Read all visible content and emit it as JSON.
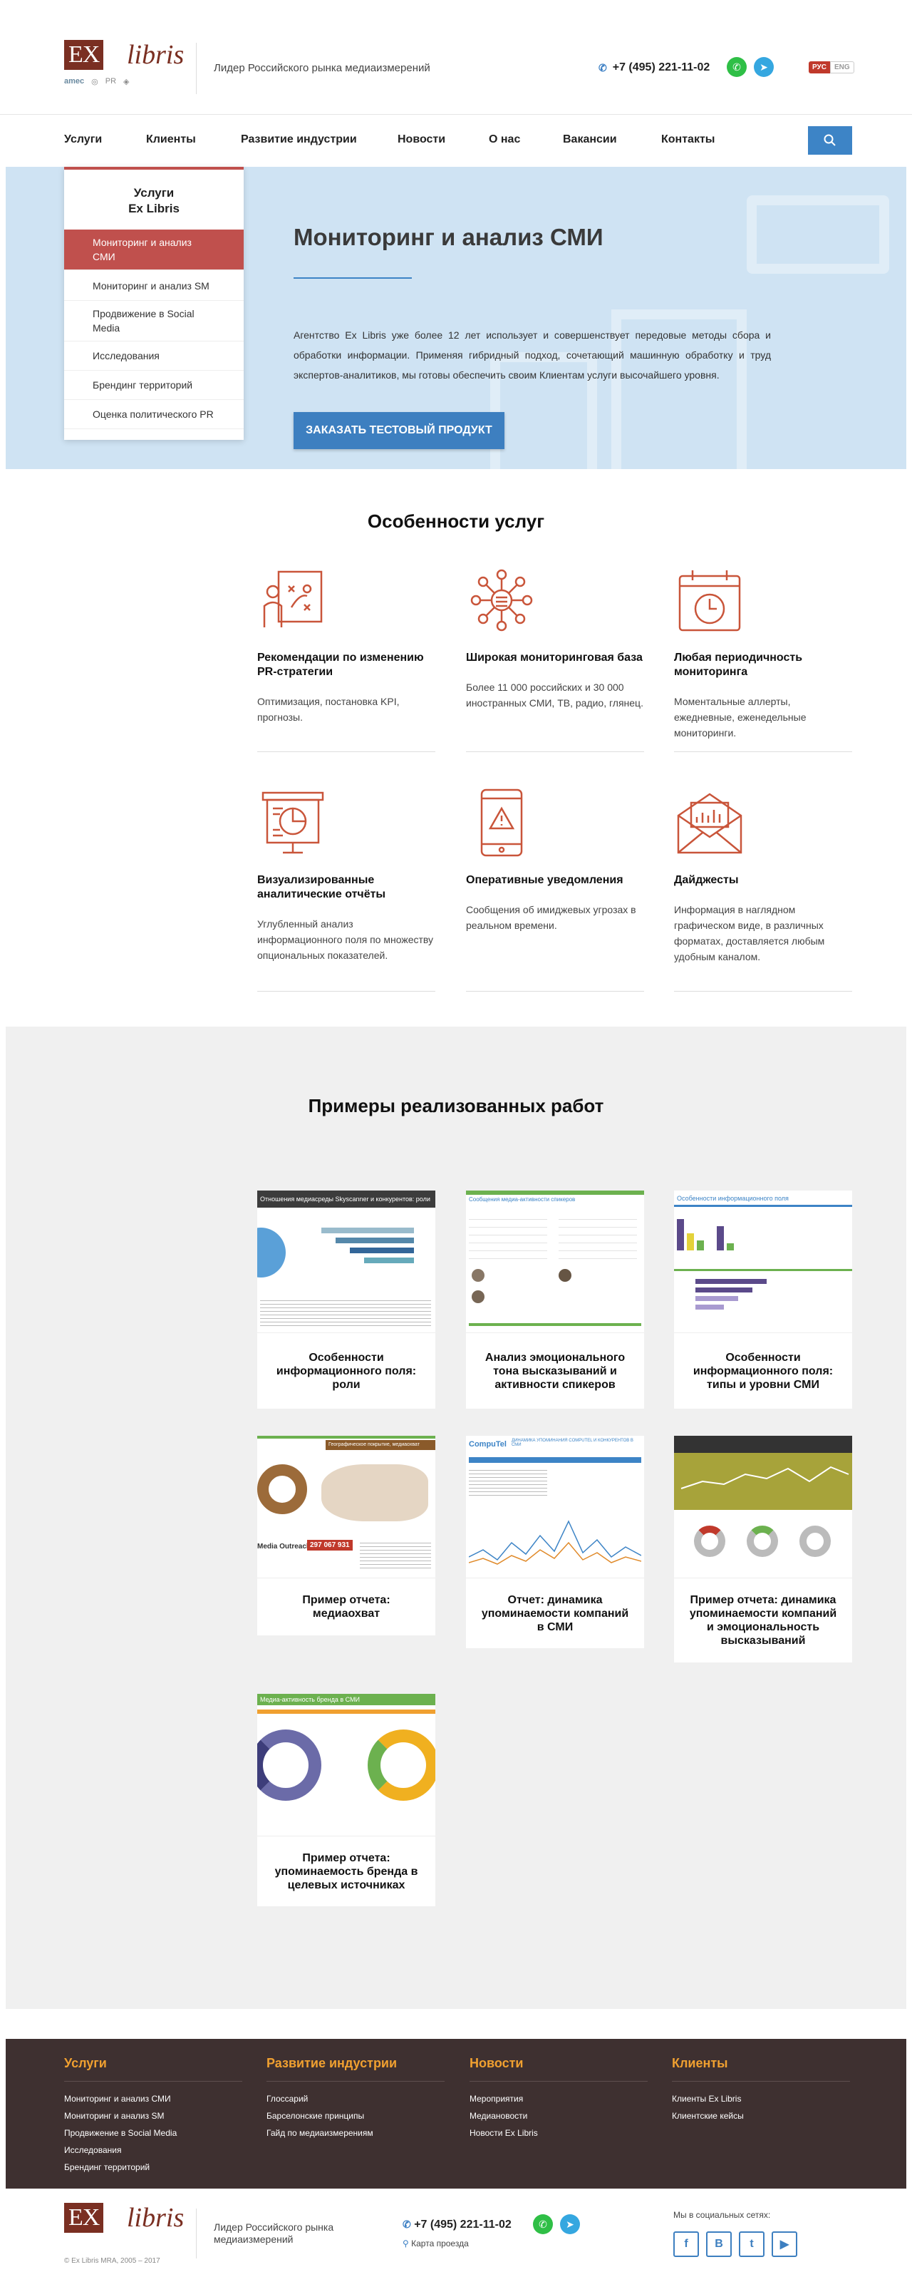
{
  "header": {
    "logo_ex": "EX",
    "logo_libris": "libris",
    "logo_sub": [
      "amec",
      "PR"
    ],
    "tagline": "Лидер Российского рынка медиаизмерений",
    "phone": "+7 (495) 221-11-02",
    "lang_ru": "РУС",
    "lang_en": "ENG"
  },
  "nav": {
    "items": [
      "Услуги",
      "Клиенты",
      "Развитие индустрии",
      "Новости",
      "О нас",
      "Вакансии",
      "Контакты"
    ]
  },
  "dropdown": {
    "title_line1": "Услуги",
    "title_line2": "Ex Libris",
    "items": [
      "Мониторинг и анализ СМИ",
      "Мониторинг и анализ SM",
      "Продвижение в Social Media",
      "Исследования",
      "Брендинг территорий",
      "Оценка политического PR"
    ]
  },
  "hero": {
    "title": "Мониторинг и анализ СМИ",
    "text": "Агентство Ex Libris уже более 12 лет использует и совершенствует передовые методы сбора и обработки информации. Применяя гибридный подход, сочетающий машинную обработку и труд экспертов-аналитиков, мы готовы обеспечить своим Клиентам услуги высочайшего уровня.",
    "button": "ЗАКАЗАТЬ ТЕСТОВЫЙ ПРОДУКТ"
  },
  "features": {
    "title": "Особенности услуг",
    "items": [
      {
        "title": "Рекомендации по изменению PR-стратегии",
        "desc": "Оптимизация, постановка KPI, прогнозы.",
        "icon": "strategy-icon"
      },
      {
        "title": "Широкая мониторинговая база",
        "desc": "Более 11 000 российских и 30 000 иностранных СМИ, ТВ, радио, глянец.",
        "icon": "network-icon"
      },
      {
        "title": "Любая периодичность мониторинга",
        "desc": "Моментальные аллерты, ежедневные, еженедельные мониторинги.",
        "icon": "calendar-clock-icon"
      },
      {
        "title": "Визуализированные аналитические отчёты",
        "desc": "Углубленный анализ информационного поля по множеству опциональных показателей.",
        "icon": "presentation-icon"
      },
      {
        "title": "Оперативные уведомления",
        "desc": "Сообщения об имиджевых угрозах в реальном времени.",
        "icon": "phone-alert-icon"
      },
      {
        "title": "Дайджесты",
        "desc": "Информация в наглядном графическом виде, в различных форматах, доставляется любым удобным каналом.",
        "icon": "envelope-chart-icon"
      }
    ]
  },
  "works": {
    "title": "Примеры реализованных работ",
    "items": [
      {
        "title": "Особенности информационного поля: роли"
      },
      {
        "title": "Анализ эмоционального тона высказываний и активности спикеров"
      },
      {
        "title": "Особенности информационного поля: типы и уровни СМИ"
      },
      {
        "title": "Пример отчета: медиаохват"
      },
      {
        "title": "Отчет: динамика упоминаемости компаний в СМИ"
      },
      {
        "title": "Пример отчета: динамика упоминаемости компаний и эмоциональность высказываний"
      },
      {
        "title": "Пример отчета: упоминаемость бренда в целевых источниках"
      }
    ],
    "thumb_text": {
      "t1": "Отношения медиасреды Skyscanner и конкурентов: роли",
      "t2": "Сообщения медиа-активности спикеров",
      "t3": "Особенности информационного поля",
      "t4": "Географическое покрытие, медиаохват",
      "t4_num": "297 067 931",
      "t4_brand": "Media Outreach",
      "t5": "ДИНАМИКА УПОМИНАНИЯ COMPUTEL И КОНКУРЕНТОВ В СМИ",
      "t5_brand": "CompuTel",
      "t7": "Медиа-активность бренда в СМИ"
    }
  },
  "footer": {
    "columns": [
      {
        "title": "Услуги",
        "items": [
          "Мониторинг и анализ СМИ",
          "Мониторинг и анализ SM",
          "Продвижение в Social Media",
          "Исследования",
          "Брендинг территорий"
        ]
      },
      {
        "title": "Развитие индустрии",
        "items": [
          "Глоссарий",
          "Барселонские принципы",
          "Гайд по медиаизмерениям"
        ]
      },
      {
        "title": "Новости",
        "items": [
          "Мероприятия",
          "Медиановости",
          "Новости Ex Libris"
        ]
      },
      {
        "title": "Клиенты",
        "items": [
          "Клиенты Ex Libris",
          "Клиентские кейсы"
        ]
      }
    ],
    "tagline": "Лидер Российского рынка медиаизмерений",
    "copyright": "© Ex Libris MRA, 2005 – 2017",
    "phone": "+7 (495) 221-11-02",
    "map": "Карта проезда",
    "social_title": "Мы в социальных сетях:",
    "social": [
      "f",
      "В",
      "t",
      "▶"
    ]
  }
}
